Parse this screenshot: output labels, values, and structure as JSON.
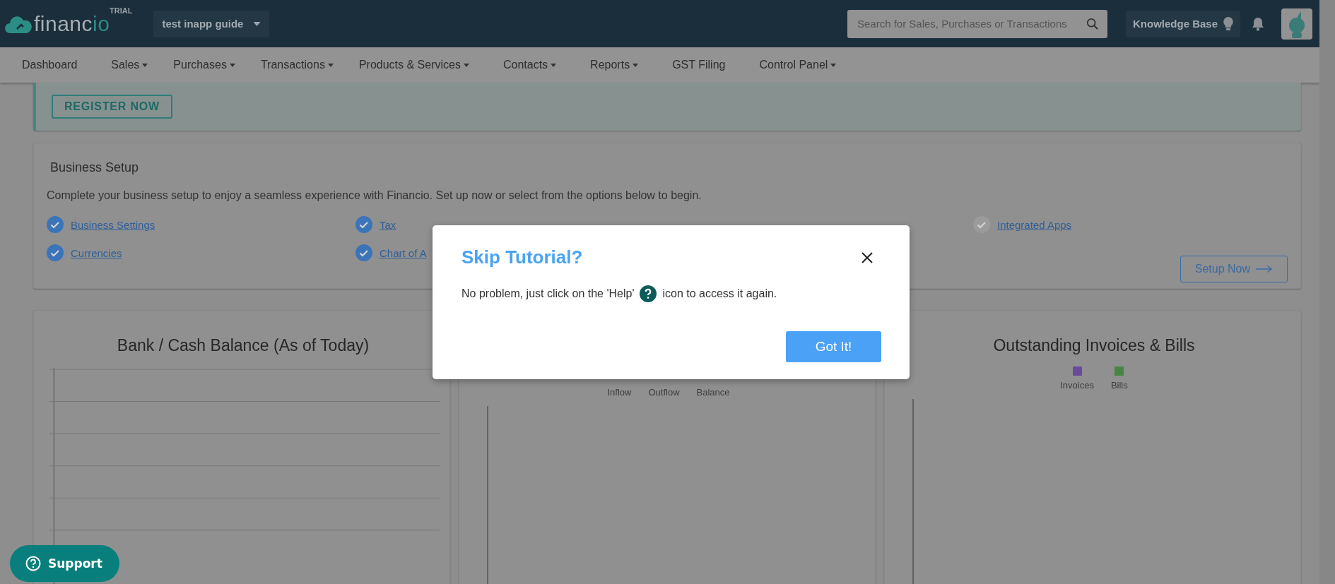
{
  "header": {
    "logo": {
      "text": "financ",
      "accent": "io",
      "badge": "TRIAL"
    },
    "company": "test inapp guide",
    "search": {
      "placeholder": "Search for Sales, Purchases or Transactions"
    },
    "knowledge_base": "Knowledge Base"
  },
  "nav": [
    {
      "label": "Dashboard",
      "dropdown": false
    },
    {
      "label": "Sales",
      "dropdown": true
    },
    {
      "label": "Purchases",
      "dropdown": true
    },
    {
      "label": "Transactions",
      "dropdown": true
    },
    {
      "label": "Products & Services",
      "dropdown": true
    },
    {
      "label": "Contacts",
      "dropdown": true
    },
    {
      "label": "Reports",
      "dropdown": true
    },
    {
      "label": "GST Filing",
      "dropdown": false
    },
    {
      "label": "Control Panel",
      "dropdown": true
    }
  ],
  "banner": {
    "button": "REGISTER NOW"
  },
  "business_setup": {
    "title": "Business Setup",
    "description": "Complete your business setup to enjoy a seamless experience with Financio. Set up now or select from the options below to begin.",
    "items": [
      {
        "label": "Business Settings",
        "checked": true
      },
      {
        "label": "Tax",
        "checked": true
      },
      {
        "label": "Integrated Apps",
        "checked": false
      },
      {
        "label": "Currencies",
        "checked": true
      },
      {
        "label": "Chart of A",
        "checked": true
      }
    ],
    "button": "Setup Now"
  },
  "charts": [
    {
      "title": "Bank / Cash Balance (As of Today)",
      "kind": "grid"
    },
    {
      "kind": "axis",
      "legend": [
        {
          "label": "Inflow"
        },
        {
          "label": "Outflow"
        },
        {
          "label": "Balance"
        }
      ]
    },
    {
      "title": "Outstanding Invoices & Bills",
      "kind": "axis",
      "legend": [
        {
          "label": "Invoices",
          "color": "#6a4a9e"
        },
        {
          "label": "Bills",
          "color": "#478547"
        }
      ]
    }
  ],
  "support": "Support",
  "dialog": {
    "title": "Skip Tutorial?",
    "body_before": "No problem, just click on the 'Help'",
    "body_after": "icon to access it again.",
    "button": "Got It!"
  }
}
